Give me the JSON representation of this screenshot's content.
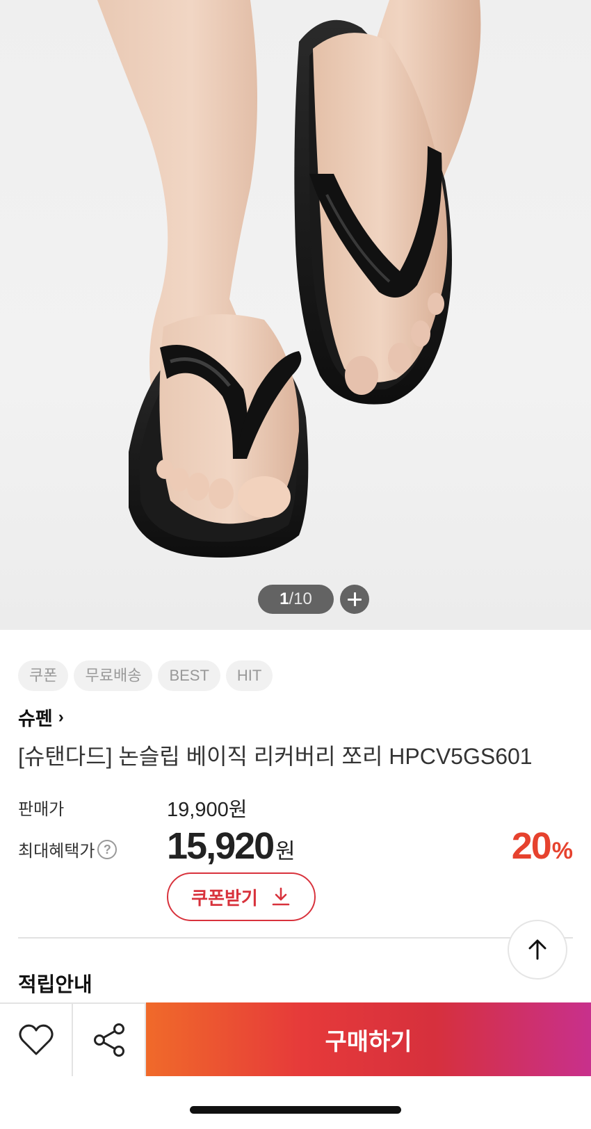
{
  "image": {
    "current": "1",
    "separator": "/",
    "total": "10"
  },
  "badges": [
    "쿠폰",
    "무료배송",
    "BEST",
    "HIT"
  ],
  "brand": {
    "name": "슈펜",
    "chevron": "›"
  },
  "product": {
    "title": "[슈탠다드] 논슬립 베이직 리커버리 쪼리 HPCV5GS601"
  },
  "price": {
    "sale_label": "판매가",
    "sale_value": "19,900원",
    "max_label": "최대혜택가",
    "help_glyph": "?",
    "max_value": "15,920",
    "max_unit": "원",
    "discount_value": "20",
    "discount_unit": "%",
    "coupon_button": "쿠폰받기"
  },
  "sections": {
    "reward_title": "적립안내"
  },
  "bottom_bar": {
    "buy_label": "구매하기"
  },
  "colors": {
    "accent": "#d8323c",
    "discount": "#e6422e",
    "buy_gradient_start": "#f06a2a",
    "buy_gradient_end": "#c8308c"
  },
  "icons": {
    "zoom": "plus-icon",
    "help": "question-circle-icon",
    "coupon": "download-icon",
    "scroll_top": "arrow-up-icon",
    "wishlist": "heart-icon",
    "share": "share-icon"
  }
}
